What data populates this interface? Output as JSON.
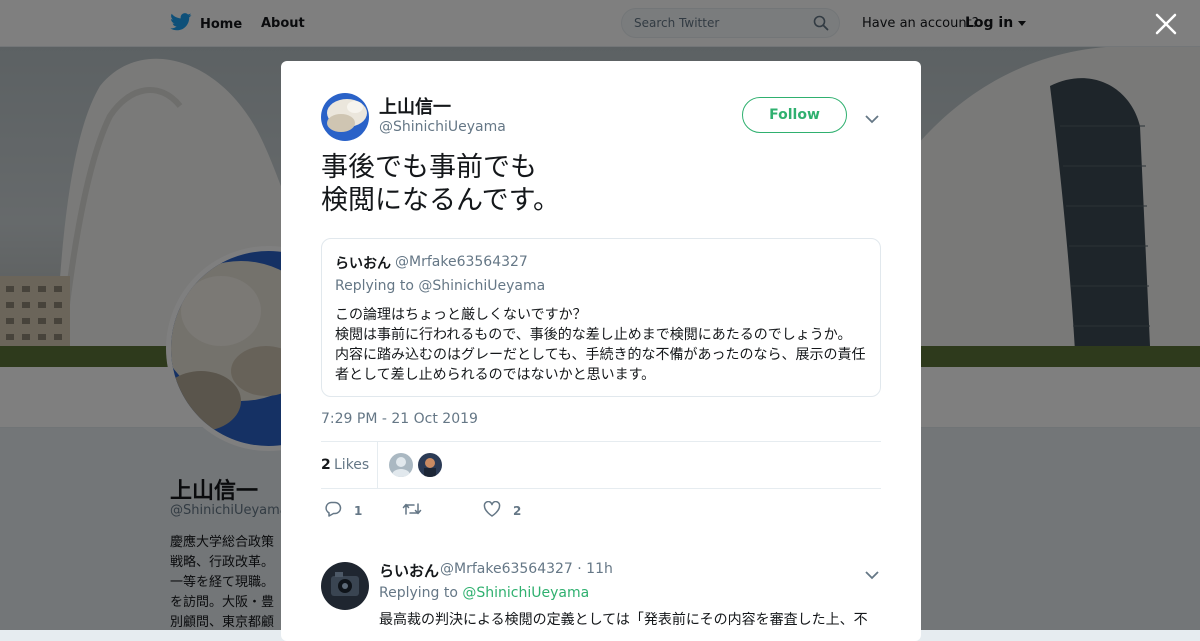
{
  "topbar": {
    "home_label": "Home",
    "about_label": "About",
    "search_placeholder": "Search Twitter",
    "have_account": "Have an account?",
    "login_label": "Log in"
  },
  "profile": {
    "name": "上山信一",
    "handle": "@ShinichiUeyama",
    "bio_lines": [
      "慶應大学総合政策",
      "戦略、行政改革。",
      "一等を経て現職。",
      "を訪問。大阪・豊",
      "別顧問、東京都顧"
    ]
  },
  "tweet": {
    "author_name": "上山信一",
    "author_handle": "@ShinichiUeyama",
    "follow_label": "Follow",
    "text_lines": [
      "事後でも事前でも",
      "検閲になるんです。"
    ],
    "quote": {
      "name": "らいおん",
      "handle": "@Mrfake63564327",
      "replying_to": "Replying to @ShinichiUeyama",
      "body_lines": [
        "この論理はちょっと厳しくないですか？",
        "検閲は事前に行われるもので、事後的な差し止めまで検閲にあたるのでしょうか。",
        "内容に踏み込むのはグレーだとしても、手続き的な不備があったのなら、展示の責任",
        "者として差し止められるのではないかと思います。"
      ]
    },
    "timestamp": "7:29 PM - 21 Oct 2019",
    "likes_count": "2",
    "likes_label": "Likes",
    "actions": {
      "reply_count": "1",
      "retweet_count": "",
      "like_count": "2"
    }
  },
  "reply": {
    "name": "らいおん",
    "handle": "@Mrfake63564327 · 11h",
    "replying_prefix": "Replying to",
    "replying_handle": "@ShinichiUeyama",
    "body": "最高裁の判決による検閲の定義としては「発表前にその内容を審査した上、不"
  },
  "colors": {
    "accent": "#2fb06f",
    "twitter_blue": "#1da1f2",
    "text": "#14171a",
    "muted": "#657786",
    "overlay": "rgba(0,0,0,0.5)"
  },
  "icons": [
    "twitter-bird-icon",
    "search-icon",
    "caret-down-icon",
    "close-icon",
    "chevron-down-icon",
    "reply-icon",
    "retweet-icon",
    "heart-icon"
  ]
}
